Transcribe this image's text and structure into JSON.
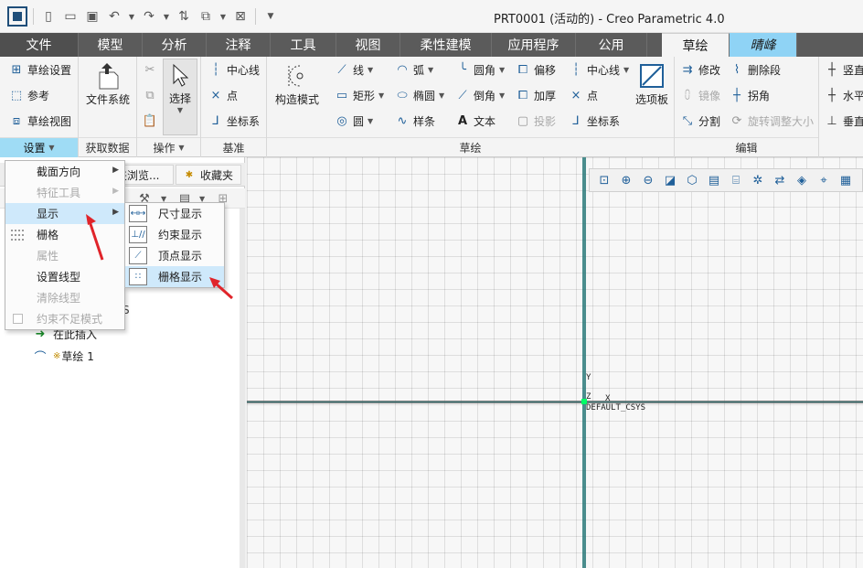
{
  "window": {
    "title": "PRT0001 (活动的) - Creo Parametric 4.0"
  },
  "tabs": [
    {
      "label": "文件"
    },
    {
      "label": "模型"
    },
    {
      "label": "分析"
    },
    {
      "label": "注释"
    },
    {
      "label": "工具"
    },
    {
      "label": "视图"
    },
    {
      "label": "柔性建模"
    },
    {
      "label": "应用程序"
    },
    {
      "label": "公用"
    },
    {
      "label": "草绘"
    },
    {
      "label": "晴峰"
    }
  ],
  "ribbon": {
    "setup": {
      "items": [
        "草绘设置",
        "参考",
        "草绘视图"
      ],
      "label": "设置"
    },
    "getdata": {
      "item": "文件系统",
      "label": "获取数据"
    },
    "operations": {
      "item": "选择",
      "label": "操作"
    },
    "datum": {
      "items": [
        "中心线",
        "点",
        "坐标系"
      ],
      "label": "基准"
    },
    "sketch": {
      "construct": "构造模式",
      "col1": [
        "线",
        "矩形",
        "圆"
      ],
      "col2": [
        "弧",
        "椭圆",
        "样条"
      ],
      "col3": [
        "圆角",
        "倒角",
        "文本"
      ],
      "col4": [
        "偏移",
        "加厚",
        "投影"
      ],
      "col5": [
        "中心线",
        "点",
        "坐标系"
      ],
      "palette": "选项板",
      "label": "草绘"
    },
    "edit": {
      "col1": [
        "修改",
        "镜像",
        "分割"
      ],
      "col2": [
        "删除段",
        "拐角",
        "旋转调整大小"
      ],
      "label": "编辑"
    },
    "constrain": {
      "items": [
        "竖直",
        "水平",
        "垂直"
      ]
    }
  },
  "leftpanel": {
    "tabs": [
      "夹浏览...",
      "收藏夹"
    ],
    "tree": [
      {
        "label": "在此插入"
      },
      {
        "label": "草绘 1",
        "mark": "※"
      }
    ],
    "partial_text": "S"
  },
  "menu1": {
    "items": [
      {
        "label": "截面方向",
        "submenu": true,
        "disabled": false
      },
      {
        "label": "特征工具",
        "submenu": true,
        "disabled": true
      },
      {
        "label": "显示",
        "submenu": true,
        "disabled": false,
        "highlight": true
      },
      {
        "label": "栅格",
        "submenu": false,
        "disabled": false
      },
      {
        "label": "属性",
        "submenu": false,
        "disabled": true
      },
      {
        "label": "设置线型",
        "submenu": false,
        "disabled": false
      },
      {
        "label": "清除线型",
        "submenu": false,
        "disabled": true
      },
      {
        "label": "约束不足模式",
        "submenu": false,
        "disabled": true
      }
    ]
  },
  "menu2": {
    "items": [
      {
        "label": "尺寸显示"
      },
      {
        "label": "约束显示"
      },
      {
        "label": "顶点显示"
      },
      {
        "label": "栅格显示",
        "highlight": true
      }
    ]
  },
  "canvas": {
    "csys_label": "DEFAULT_CSYS",
    "axis_y": "Y",
    "axis_x": "X",
    "axis_z": "Z"
  },
  "colors": {
    "tab_bar": "#5b5b5b",
    "active_group": "#9fdcf5",
    "menu_highlight": "#cfe9fb",
    "arrow": "#e0242a"
  }
}
